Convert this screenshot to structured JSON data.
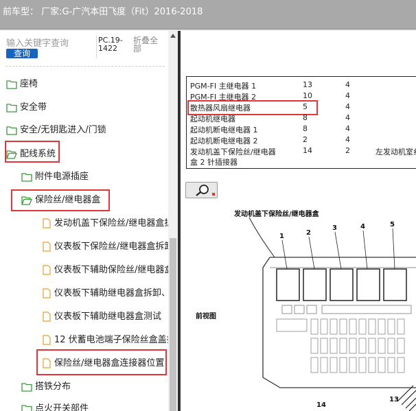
{
  "titlebar": {
    "title": "前车型：  厂家:G-广汽本田飞度（Fit）2016-2018"
  },
  "search": {
    "placeholder": "输入关键字查询",
    "button_label": "查询",
    "pc_code": "PC.19-1422",
    "collapse_label": "折叠全部"
  },
  "tree": {
    "items": [
      {
        "label": "座椅",
        "icon": "folder-icon"
      },
      {
        "label": "安全带",
        "icon": "folder-icon"
      },
      {
        "label": "安全/无钥匙进入/门锁",
        "icon": "folder-icon"
      },
      {
        "label": "配线系统",
        "icon": "folder-open-icon",
        "highlighted": true
      },
      {
        "label": "附件电源插座",
        "icon": "folder-icon"
      },
      {
        "label": "保险丝/继电器盒",
        "icon": "folder-open-icon",
        "highlighted": true
      },
      {
        "label": "发动机盖下保险丝/继电器盒拆",
        "icon": "document-icon"
      },
      {
        "label": "仪表板下保险丝/继电器盒拆卸",
        "icon": "document-icon"
      },
      {
        "label": "仪表板下辅助保险丝/继电器盒",
        "icon": "document-icon"
      },
      {
        "label": "仪表板下辅助继电器盒拆卸、",
        "icon": "document-icon"
      },
      {
        "label": "仪表板下辅助继电器盒测试",
        "icon": "document-icon"
      },
      {
        "label": "12 伏蓄电池端子保险丝盒盖拆",
        "icon": "document-icon"
      },
      {
        "label": "保险丝/继电器盒连接器位置",
        "icon": "document-icon",
        "highlighted": true,
        "selected": true
      },
      {
        "label": "搭铁分布",
        "icon": "folder-icon"
      },
      {
        "label": "点火开关部件",
        "icon": "folder-icon"
      }
    ]
  },
  "document": {
    "table_rows": [
      {
        "name": "PGM-FI 主继电器 1",
        "v1": "13",
        "v2": "4",
        "v3": ""
      },
      {
        "name": "PGM-FI 主继电器 2",
        "v1": "10",
        "v2": "4",
        "v3": ""
      },
      {
        "name": "散热器风扇继电器",
        "v1": "5",
        "v2": "4",
        "v3": "",
        "highlighted": true
      },
      {
        "name": "起动机继电器",
        "v1": "8",
        "v2": "4",
        "v3": ""
      },
      {
        "name": "起动机断电继电器 1",
        "v1": "8",
        "v2": "4",
        "v3": ""
      },
      {
        "name": "起动机断电继电器 2",
        "v1": "2",
        "v2": "4",
        "v3": ""
      },
      {
        "name": "发动机盖下保险丝/继电器",
        "v1": "14",
        "v2": "2",
        "v3": "左发动机室纟"
      },
      {
        "name": "盒 2 针插接器",
        "v1": "",
        "v2": "",
        "v3": ""
      }
    ],
    "diagram_title": "发动机盖下保险丝/继电器盒",
    "front_view_label": "前视图",
    "callout_numbers": [
      "1",
      "2",
      "3",
      "4",
      "5",
      "14",
      "13"
    ]
  },
  "colors": {
    "highlight": "#e0353a",
    "button": "#1565c0",
    "folder": "#3a9a3a",
    "doc_icon": "#e8a030"
  }
}
